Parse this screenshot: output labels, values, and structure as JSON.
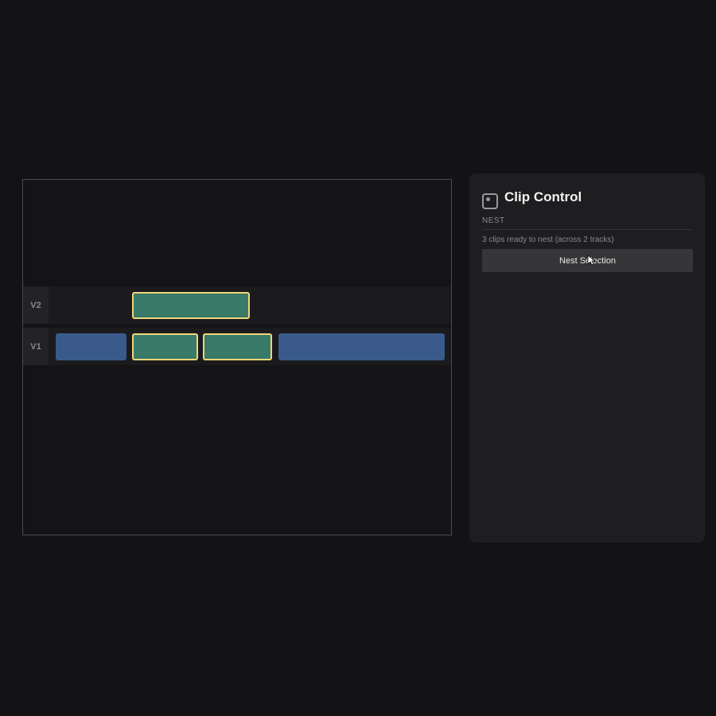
{
  "timeline": {
    "tracks": [
      {
        "label": "V2",
        "clips": [
          {
            "color": "green",
            "selected": true
          }
        ]
      },
      {
        "label": "V1",
        "clips": [
          {
            "color": "blue",
            "selected": false
          },
          {
            "color": "green",
            "selected": true
          },
          {
            "color": "green",
            "selected": true
          },
          {
            "color": "blue",
            "selected": false
          }
        ]
      }
    ]
  },
  "panel": {
    "icon": "clip-control-icon",
    "title": "Clip Control",
    "section_label": "NEST",
    "status": "3 clips ready to nest (across 2 tracks)",
    "nest_button_label": "Nest Selection"
  },
  "colors": {
    "clip_blue": "#3b5a8c",
    "clip_green": "#3a7a68",
    "selection_outline": "#f0d67a",
    "background": "#131315",
    "panel_bg": "#1e1e20"
  }
}
